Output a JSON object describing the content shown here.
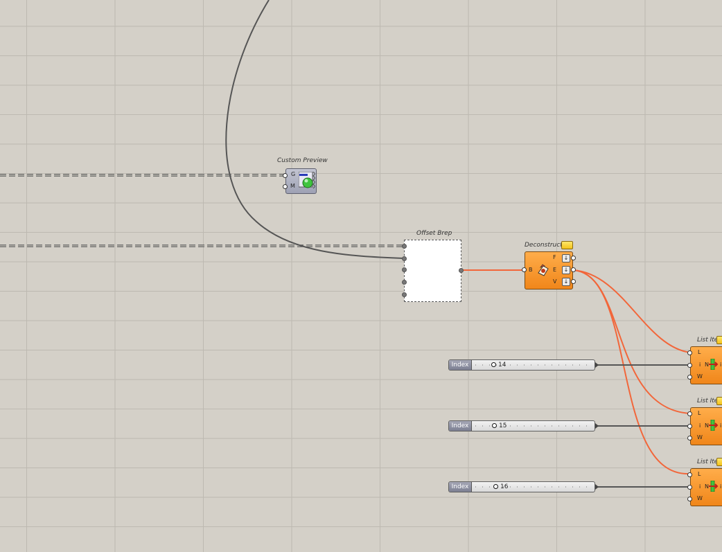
{
  "canvas": {
    "background": "#d4d0c8",
    "grid_color": "#bdb9b1",
    "wire_color": "#555555",
    "selected_wire_color": "#f2663a"
  },
  "custom_preview": {
    "title": "Custom Preview",
    "inputs": [
      "G",
      "M"
    ],
    "icon": "preview-sphere-icon"
  },
  "offset_brep": {
    "title": "Offset Brep"
  },
  "deconstruct": {
    "title": "Deconstruct",
    "input": "B",
    "outputs": [
      "F",
      "E",
      "V"
    ],
    "icon": "deconstruct-brep-icon"
  },
  "sliders": [
    {
      "label": "Index",
      "value": "14",
      "fraction": 0.14
    },
    {
      "label": "Index",
      "value": "15",
      "fraction": 0.15
    },
    {
      "label": "Index",
      "value": "16",
      "fraction": 0.16
    }
  ],
  "list_items": [
    {
      "title": "List Ite",
      "inputs": [
        "L",
        "i",
        "W"
      ],
      "middle": "N",
      "output": "i"
    },
    {
      "title": "List Ite",
      "inputs": [
        "L",
        "i",
        "W"
      ],
      "middle": "N",
      "output": "i"
    },
    {
      "title": "List Ite",
      "inputs": [
        "L",
        "i",
        "W"
      ],
      "middle": "N",
      "output": "i"
    }
  ]
}
